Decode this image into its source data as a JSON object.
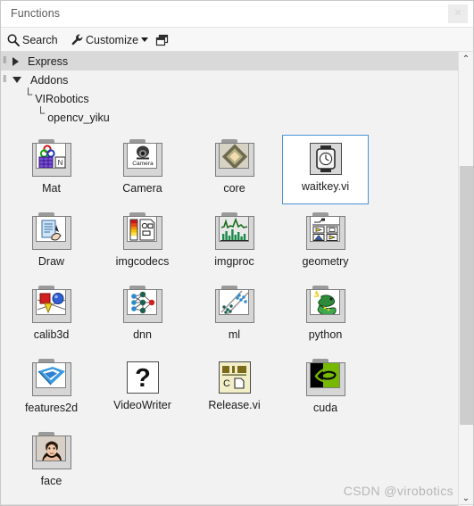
{
  "window": {
    "title": "Functions",
    "close_label": "✕"
  },
  "toolbar": {
    "search_label": "Search",
    "customize_label": "Customize",
    "search_icon": "search-icon",
    "wrench_icon": "wrench-icon",
    "caret_icon": "chevron-down-icon",
    "window_icon": "restore-window-icon"
  },
  "tree": {
    "rows": [
      {
        "label": "Express",
        "level": 1,
        "expanded": false,
        "shaded": true,
        "marker": "triangle-right"
      },
      {
        "label": "Addons",
        "level": 1,
        "expanded": true,
        "shaded": false,
        "marker": "triangle-down"
      },
      {
        "label": "VIRobotics",
        "level": 2,
        "expanded": null,
        "shaded": false,
        "marker": "elbow"
      },
      {
        "label": "opencv_yiku",
        "level": 3,
        "expanded": null,
        "shaded": false,
        "marker": "elbow"
      }
    ],
    "elbow_glyph": "└",
    "gripper_glyph": "‖"
  },
  "palette": {
    "rows": [
      [
        {
          "label": "Mat",
          "icon": "mat-folder-icon",
          "kind": "folder",
          "selected": false
        },
        {
          "label": "Camera",
          "icon": "camera-folder-icon",
          "kind": "folder",
          "selected": false
        },
        {
          "label": "core",
          "icon": "core-folder-icon",
          "kind": "folder",
          "selected": false
        },
        {
          "label": "waitkey.vi",
          "icon": "waitkey-vi-icon",
          "kind": "vi",
          "selected": true
        }
      ],
      [
        {
          "label": "Draw",
          "icon": "draw-folder-icon",
          "kind": "folder",
          "selected": false
        },
        {
          "label": "imgcodecs",
          "icon": "imgcodecs-folder-icon",
          "kind": "folder",
          "selected": false
        },
        {
          "label": "imgproc",
          "icon": "imgproc-folder-icon",
          "kind": "folder",
          "selected": false
        },
        {
          "label": "geometry",
          "icon": "geometry-folder-icon",
          "kind": "folder",
          "selected": false
        }
      ],
      [
        {
          "label": "calib3d",
          "icon": "calib3d-folder-icon",
          "kind": "folder",
          "selected": false
        },
        {
          "label": "dnn",
          "icon": "dnn-folder-icon",
          "kind": "folder",
          "selected": false
        },
        {
          "label": "ml",
          "icon": "ml-folder-icon",
          "kind": "folder",
          "selected": false
        },
        {
          "label": "python",
          "icon": "python-folder-icon",
          "kind": "folder",
          "selected": false
        }
      ],
      [
        {
          "label": "features2d",
          "icon": "features2d-folder-icon",
          "kind": "folder",
          "selected": false
        },
        {
          "label": "VideoWriter",
          "icon": "videowriter-question-icon",
          "kind": "vi",
          "selected": false
        },
        {
          "label": "Release.vi",
          "icon": "release-vi-icon",
          "kind": "vi",
          "selected": false
        },
        {
          "label": "cuda",
          "icon": "cuda-folder-icon",
          "kind": "folder",
          "selected": false
        }
      ],
      [
        {
          "label": "face",
          "icon": "face-folder-icon",
          "kind": "folder",
          "selected": false
        }
      ]
    ]
  },
  "scrollbar": {
    "up_glyph": "⌃",
    "down_glyph": "⌄"
  },
  "watermark": {
    "text": "CSDN @virobotics"
  },
  "colors": {
    "selection_border": "#4a93d9",
    "panel_bg": "#f2f2f2",
    "tree_shaded": "#d9d9d9",
    "scroll_thumb": "#cdcdcd",
    "watermark": "#b6b6b6"
  }
}
